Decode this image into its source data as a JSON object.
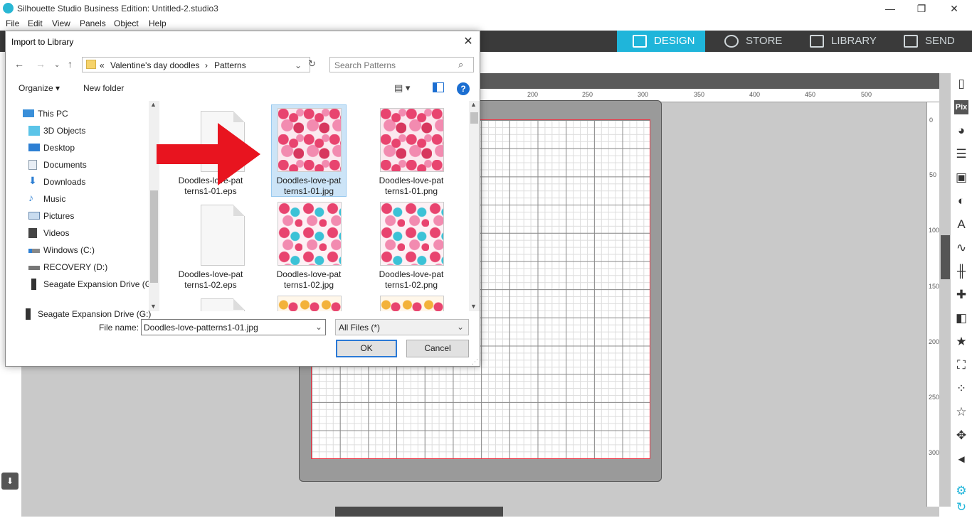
{
  "app": {
    "title": "Silhouette Studio Business Edition: Untitled-2.studio3",
    "window_controls": [
      "—",
      "❐",
      "✕"
    ],
    "menus": [
      "File",
      "Edit",
      "View",
      "Panels",
      "Object",
      "Help"
    ],
    "nav_tabs": [
      "DESIGN",
      "STORE",
      "LIBRARY",
      "SEND"
    ],
    "accent_color": "#1fb5da"
  },
  "ruler": {
    "h_ticks": [
      "200",
      "250",
      "300",
      "350",
      "400",
      "450",
      "500"
    ],
    "v_ticks": [
      "0",
      "50",
      "100",
      "150",
      "200",
      "250",
      "300"
    ]
  },
  "right_tools": [
    "Pix"
  ],
  "dialog": {
    "title": "Import to Library",
    "close": "✕",
    "breadcrumb": {
      "prefix": "«",
      "parts": [
        "Valentine's day doodles",
        "Patterns"
      ],
      "sep": "›"
    },
    "search_placeholder": "Search Patterns",
    "organize_label": "Organize ▾",
    "new_folder_label": "New folder",
    "help": "?",
    "nav_items": [
      {
        "label": "This PC",
        "icon": "pc-icon"
      },
      {
        "label": "3D Objects",
        "icon": "cube-icon"
      },
      {
        "label": "Desktop",
        "icon": "desktop-icon"
      },
      {
        "label": "Documents",
        "icon": "document-icon"
      },
      {
        "label": "Downloads",
        "icon": "download-icon"
      },
      {
        "label": "Music",
        "icon": "music-icon"
      },
      {
        "label": "Pictures",
        "icon": "pictures-icon"
      },
      {
        "label": "Videos",
        "icon": "video-icon"
      },
      {
        "label": "Windows (C:)",
        "icon": "drive-icon"
      },
      {
        "label": "RECOVERY (D:)",
        "icon": "drive-icon"
      },
      {
        "label": "Seagate Expansion Drive (G:",
        "icon": "external-drive-icon"
      }
    ],
    "nav_last": "Seagate Expansion Drive (G:)",
    "files": [
      {
        "line1": "Doodles-love-pat",
        "line2": "terns1-01.eps",
        "kind": "doc"
      },
      {
        "line1": "Doodles-love-pat",
        "line2": "terns1-01.jpg",
        "kind": "pat1",
        "selected": true
      },
      {
        "line1": "Doodles-love-pat",
        "line2": "terns1-01.png",
        "kind": "pat1"
      },
      {
        "line1": "Doodles-love-pat",
        "line2": "terns1-02.eps",
        "kind": "doc"
      },
      {
        "line1": "Doodles-love-pat",
        "line2": "terns1-02.jpg",
        "kind": "pat2"
      },
      {
        "line1": "Doodles-love-pat",
        "line2": "terns1-02.png",
        "kind": "pat2"
      }
    ],
    "file_name_label": "File name:",
    "file_name_value": "Doodles-love-patterns1-01.jpg",
    "file_type_value": "All Files (*)",
    "ok_label": "OK",
    "cancel_label": "Cancel"
  }
}
